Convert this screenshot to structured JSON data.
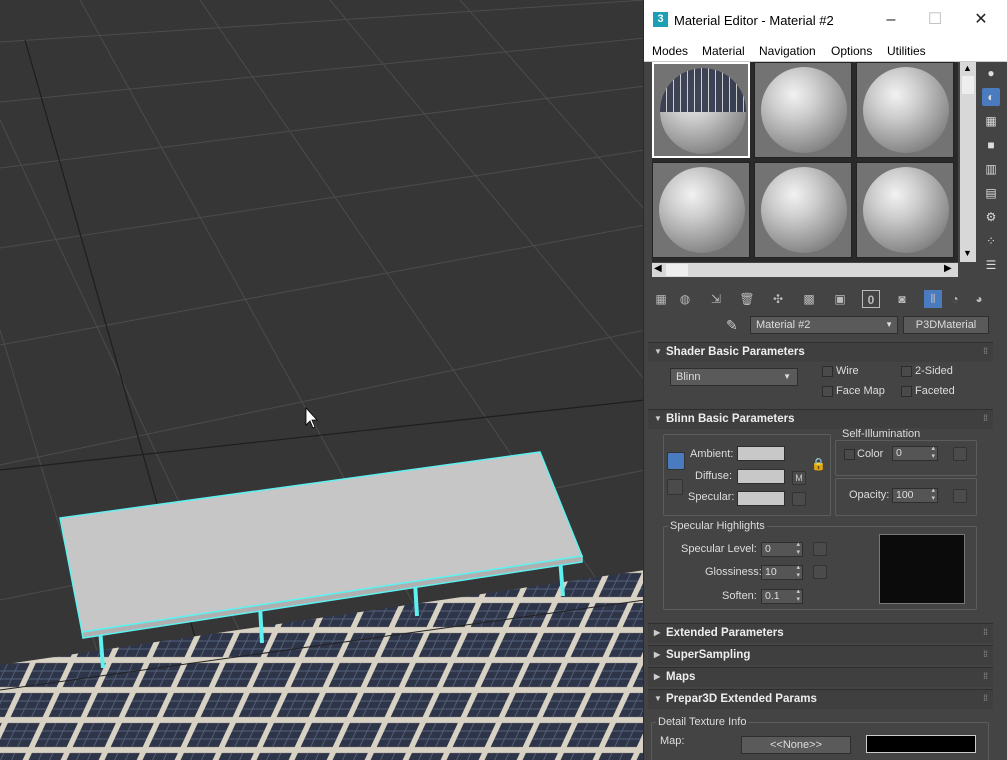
{
  "window": {
    "title": "Material Editor - Material #2",
    "app_icon": "3"
  },
  "menu": [
    "Modes",
    "Material",
    "Navigation",
    "Options",
    "Utilities"
  ],
  "material": {
    "name": "Material #2",
    "type": "P3DMaterial"
  },
  "shader": {
    "rollout": "Shader Basic Parameters",
    "type": "Blinn",
    "wire": "Wire",
    "two_sided": "2-Sided",
    "face_map": "Face Map",
    "faceted": "Faceted"
  },
  "blinn": {
    "rollout": "Blinn Basic Parameters",
    "ambient": "Ambient:",
    "diffuse": "Diffuse:",
    "specular": "Specular:",
    "map_btn": "M",
    "self_illum": "Self-Illumination",
    "color": "Color",
    "color_value": "0",
    "opacity": "Opacity:",
    "opacity_value": "100",
    "spec_group": "Specular Highlights",
    "spec_level": "Specular Level:",
    "spec_level_value": "0",
    "glossiness": "Glossiness:",
    "glossiness_value": "10",
    "soften": "Soften:",
    "soften_value": "0.1"
  },
  "rollouts": {
    "extended": "Extended Parameters",
    "supersampling": "SuperSampling",
    "maps": "Maps",
    "prepar3d": "Prepar3D Extended Params"
  },
  "prepar3d": {
    "detail": "Detail Texture Info",
    "map": "Map:",
    "none": "<<None>>"
  },
  "colors": {
    "selection": "#5ff0f0",
    "swatch_grey": "#c8c8c8",
    "accent": "#1b9fb4"
  }
}
